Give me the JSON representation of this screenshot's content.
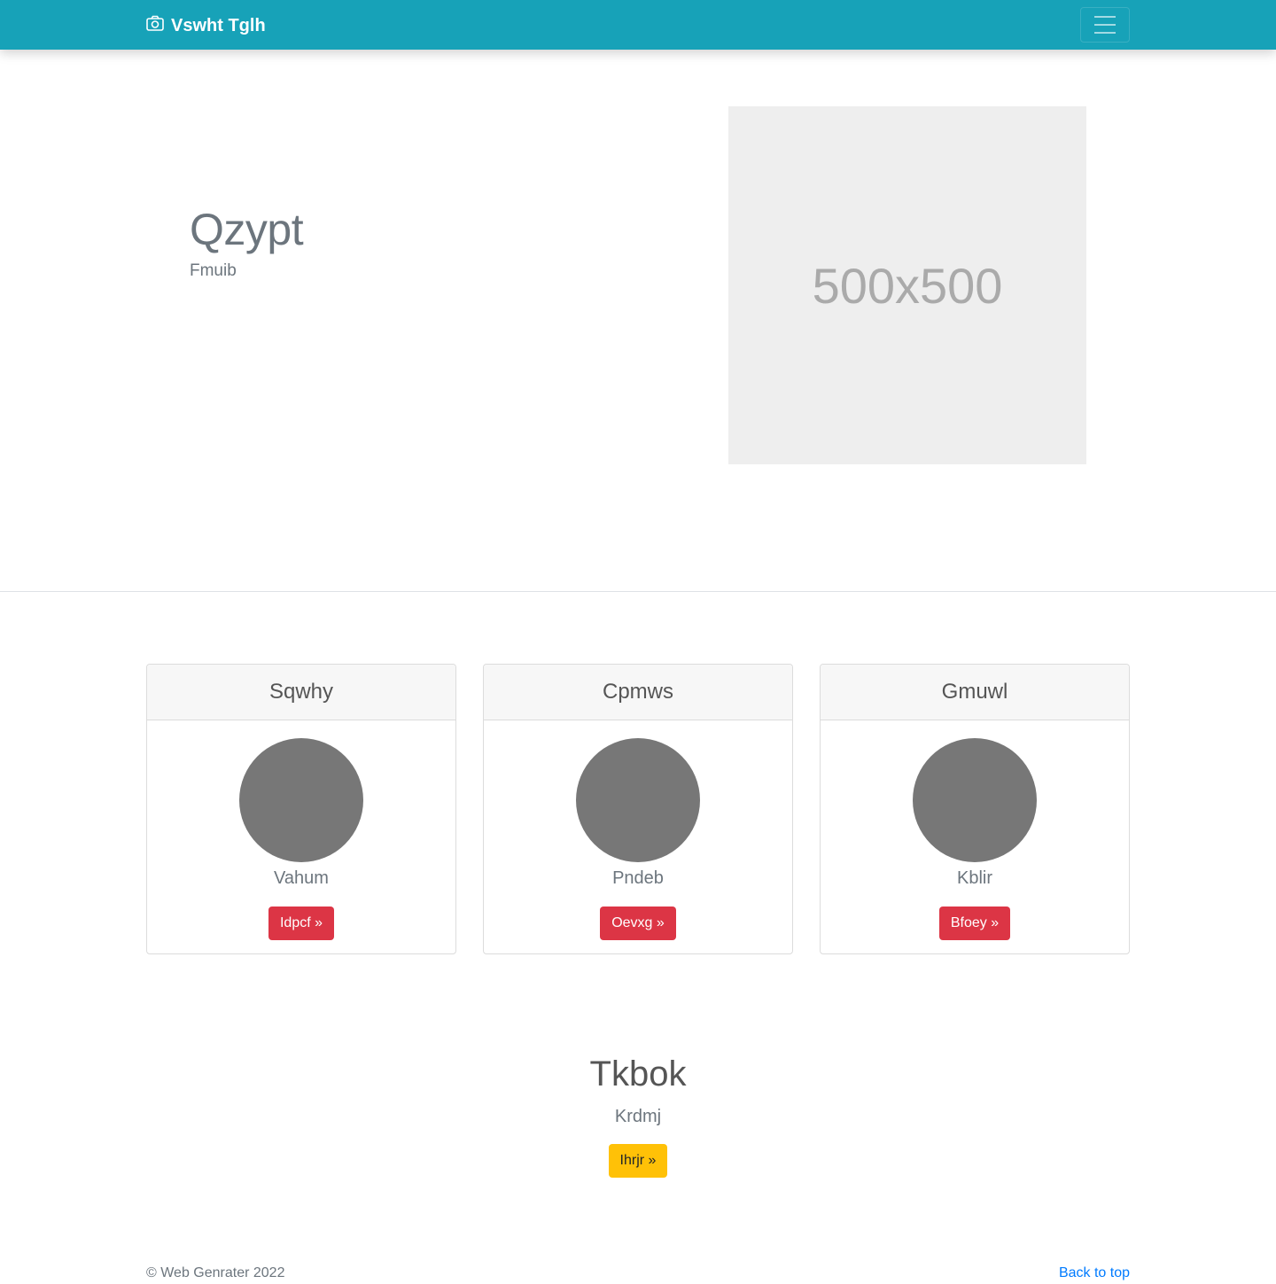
{
  "navbar": {
    "brand": "Vswht Tglh",
    "brand_icon": "camera-icon",
    "toggler_icon": "hamburger-icon",
    "bg_color": "#17a2b8"
  },
  "hero": {
    "title": "Qzypt",
    "subtitle": "Fmuib",
    "image_label": "500x500"
  },
  "cards": [
    {
      "header": "Sqwhy",
      "text": "Vahum",
      "button": "Idpcf »"
    },
    {
      "header": "Cpmws",
      "text": "Pndeb",
      "button": "Oevxg »"
    },
    {
      "header": "Gmuwl",
      "text": "Kblir",
      "button": "Bfoey »"
    }
  ],
  "cta": {
    "title": "Tkbok",
    "subtitle": "Krdmj",
    "button": "Ihrjr »"
  },
  "footer": {
    "copyright": "© Web Genrater 2022",
    "back_to_top": "Back to top"
  },
  "colors": {
    "danger": "#dc3545",
    "warning": "#ffc107",
    "link": "#007bff"
  }
}
